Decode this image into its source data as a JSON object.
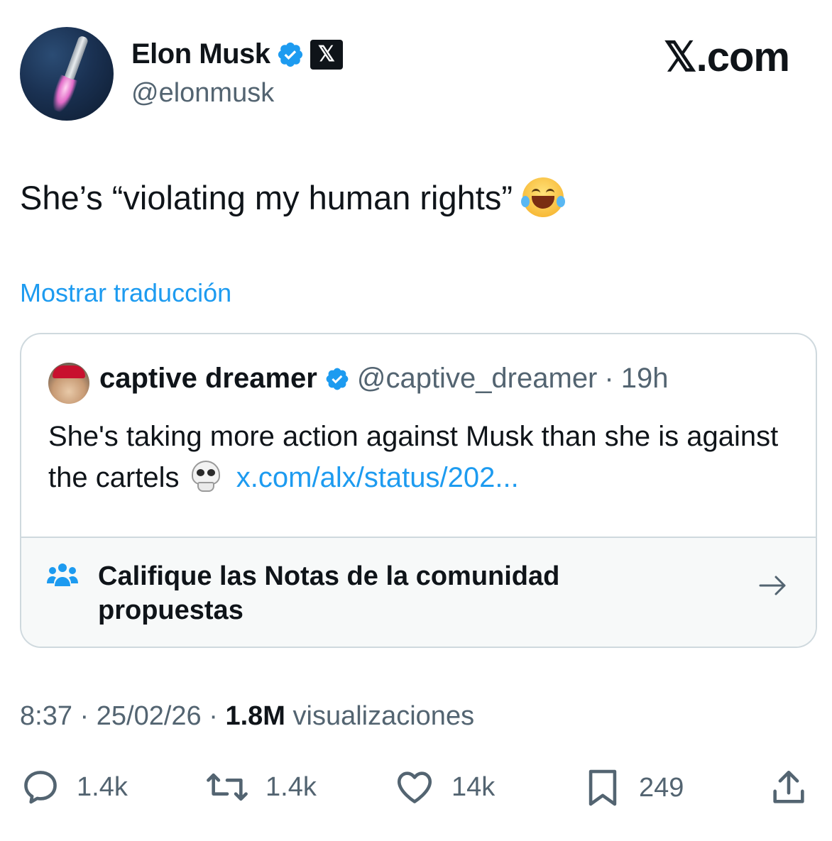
{
  "author": {
    "name": "Elon Musk",
    "handle": "@elonmusk",
    "brand": "𝕏.com",
    "badge_glyph": "𝕏"
  },
  "tweet": {
    "text": "She’s “violating my human rights”",
    "translate_label": "Mostrar traducción"
  },
  "quote": {
    "name": "captive dreamer",
    "handle": "@captive_dreamer",
    "separator": "·",
    "time": "19h",
    "text": "She's taking more action against Musk than she is against the cartels",
    "link": "x.com/alx/status/202..."
  },
  "community_notes": {
    "label": "Califique las Notas de la comunidad propuestas"
  },
  "meta": {
    "time": "8:37",
    "date": "25/02/26",
    "sep": "·",
    "views_count": "1.8M",
    "views_label": "visualizaciones"
  },
  "actions": {
    "replies": "1.4k",
    "reposts": "1.4k",
    "likes": "14k",
    "bookmarks": "249"
  },
  "colors": {
    "accent": "#1d9bf0",
    "text": "#0f1419",
    "muted": "#536471",
    "border": "#cfd9de",
    "verified": "#1d9bf0"
  }
}
